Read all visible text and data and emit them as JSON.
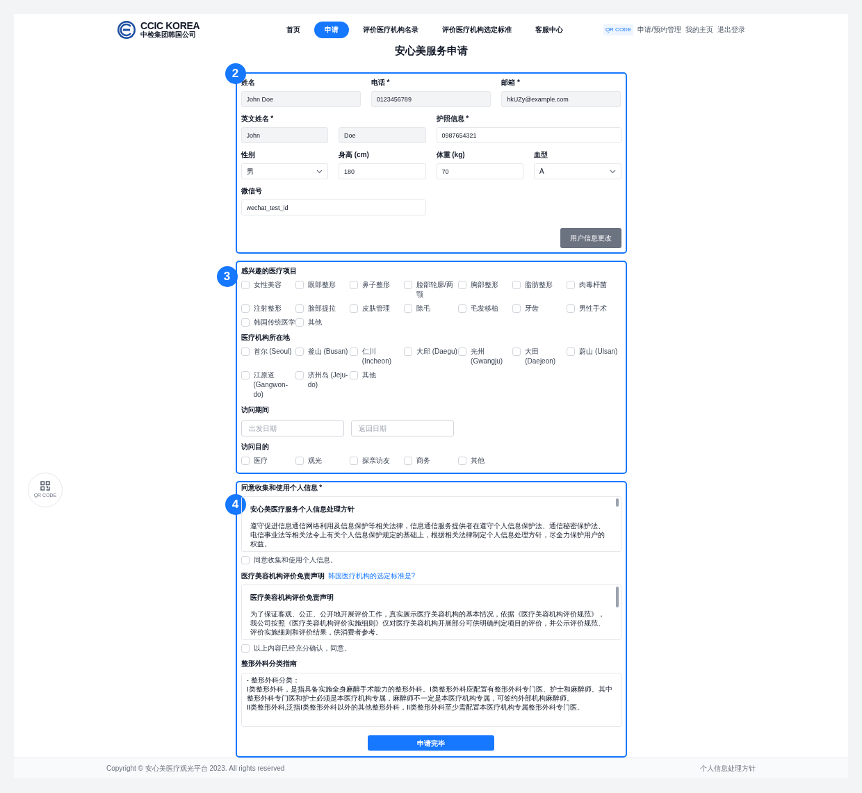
{
  "header": {
    "logo": {
      "title": "CCIC KOREA",
      "subtitle": "中检集团韩国公司"
    },
    "nav": [
      {
        "label": "首页",
        "selected": false
      },
      {
        "label": "申请",
        "selected": true
      },
      {
        "label": "评价医疗机构名录",
        "selected": false
      },
      {
        "label": "评价医疗机构选定标准",
        "selected": false
      },
      {
        "label": "客服中心",
        "selected": false
      }
    ],
    "top_links": [
      {
        "label": "QR CODE",
        "kind": "badge"
      },
      {
        "label": "申请/预约管理",
        "kind": "link"
      },
      {
        "label": "我的主页",
        "kind": "link"
      },
      {
        "label": "退出登录",
        "kind": "link"
      }
    ]
  },
  "page_title": "安心美服务申请",
  "floating_qr": {
    "label": "QR CODE"
  },
  "profile": {
    "marker": "2",
    "contact": [
      {
        "label": "姓名",
        "inputs": [
          {
            "kind": "text",
            "value": "John Doe",
            "readonly": true
          }
        ]
      },
      {
        "label": "电话 *",
        "inputs": [
          {
            "kind": "text",
            "value": "0123456789",
            "readonly": true
          }
        ]
      },
      {
        "label": "邮箱 *",
        "inputs": [
          {
            "kind": "text",
            "value": "hkUZy@example.com",
            "readonly": true
          }
        ]
      }
    ],
    "details": [
      {
        "label": "英文姓名 *",
        "inputs": [
          {
            "kind": "text",
            "value": "John",
            "readonly": true
          },
          {
            "kind": "text",
            "value": "Doe",
            "readonly": true
          }
        ]
      },
      {
        "label": "护照信息 *",
        "inputs": [
          {
            "kind": "text",
            "value": "0987654321",
            "readonly": false
          }
        ]
      },
      {
        "label": "性别",
        "inputs": [
          {
            "kind": "select",
            "value": "男",
            "readonly": false
          }
        ]
      },
      {
        "label": "身高 (cm)",
        "inputs": [
          {
            "kind": "text",
            "value": "180",
            "readonly": false
          }
        ]
      },
      {
        "label": "体重 (kg)",
        "inputs": [
          {
            "kind": "text",
            "value": "70",
            "readonly": false
          }
        ]
      },
      {
        "label": "血型",
        "inputs": [
          {
            "kind": "select",
            "value": "A",
            "readonly": false
          }
        ]
      },
      {
        "label": "微信号",
        "inputs": [
          {
            "kind": "text",
            "value": "wechat_test_id",
            "readonly": false
          }
        ]
      }
    ],
    "button": "用户信息更改"
  },
  "preferences": {
    "marker": "3",
    "groups": [
      {
        "kind": "checkboxes",
        "title": "感兴趣的医疗项目",
        "options": [
          {
            "label": "女性美容",
            "checked": false
          },
          {
            "label": "眼部整形",
            "checked": false
          },
          {
            "label": "鼻子整形",
            "checked": false
          },
          {
            "label": "脸部轮廓/两颚",
            "checked": false
          },
          {
            "label": "胸部整形",
            "checked": false
          },
          {
            "label": "脂肪整形",
            "checked": false
          },
          {
            "label": "肉毒杆菌",
            "checked": false
          },
          {
            "label": "注射整形",
            "checked": false
          },
          {
            "label": "脸部提拉",
            "checked": false
          },
          {
            "label": "皮肤管理",
            "checked": false
          },
          {
            "label": "除毛",
            "checked": false
          },
          {
            "label": "毛发移植",
            "checked": false
          },
          {
            "label": "牙齿",
            "checked": false
          },
          {
            "label": "男性手术",
            "checked": false
          },
          {
            "label": "韩国传统医学",
            "checked": false
          },
          {
            "label": "其他",
            "checked": false
          }
        ]
      },
      {
        "kind": "checkboxes",
        "title": "医疗机构所在地",
        "options": [
          {
            "label": "首尔 (Seoul)",
            "checked": false
          },
          {
            "label": "釜山 (Busan)",
            "checked": false
          },
          {
            "label": "仁川 (Incheon)",
            "checked": false
          },
          {
            "label": "大邱 (Daegu)",
            "checked": false
          },
          {
            "label": "光州 (Gwangju)",
            "checked": false
          },
          {
            "label": "大田 (Daejeon)",
            "checked": false
          },
          {
            "label": "蔚山 (Ulsan)",
            "checked": false
          },
          {
            "label": "江原道 (Gangwon-do)",
            "checked": false
          },
          {
            "label": "济州岛 (Jeju-do)",
            "checked": false
          },
          {
            "label": "其他",
            "checked": false
          }
        ]
      },
      {
        "kind": "dates",
        "title": "访问期间",
        "fields": [
          {
            "placeholder": "出发日期"
          },
          {
            "placeholder": "返回日期"
          }
        ]
      },
      {
        "kind": "checkboxes",
        "title": "访问目的",
        "options": [
          {
            "label": "医疗",
            "checked": false
          },
          {
            "label": "观光",
            "checked": false
          },
          {
            "label": "探亲访友",
            "checked": false
          },
          {
            "label": "商务",
            "checked": false
          },
          {
            "label": "其他",
            "checked": false
          }
        ]
      }
    ]
  },
  "consent": {
    "marker": "4",
    "blocks": [
      {
        "kind": "policy",
        "label": "同意收集和使用个人信息 *",
        "heading": "安心美医疗服务个人信息处理方针",
        "body": "遵守促进信息通信网络利用及信息保护等相关法律，信息通信服务提供者在遵守个人信息保护法、通信秘密保护法、电信事业法等相关法令上有关个人信息保护规定的基础上，根据相关法律制定个人信息处理方针，尽全力保护用户的权益。",
        "agree": {
          "label": "同意收集和使用个人信息。",
          "checked": false
        }
      },
      {
        "kind": "policy",
        "label": "医疗美容机构评价免责声明",
        "link": "韩国医疗机构的选定标准是?",
        "heading": "医疗美容机构评价免责声明",
        "body": "为了保证客观、公正、公开地开展评价工作，真实展示医疗美容机构的基本情况，依据《医疗美容机构评价规范》，我公司按照《医疗美容机构评价实施细则》仅对医疗美容机构开展部分可供明确判定项目的评价，并公示评价规范、评价实施细则和评价结果，供消费者参考。",
        "agree": {
          "label": "以上内容已经充分确认，同意。",
          "checked": false
        }
      },
      {
        "kind": "guide",
        "label": "整形外科分类指南",
        "lines": [
          "- 整形外科分类：",
          "Ⅰ类整形外科，是指具备实施全身麻醉手术能力的整形外科。Ⅰ类整形外科应配置有整形外科专门医、护士和麻醉师。其中整形外科专门医和护士必须是本医疗机构专属，麻醉师不一定是本医疗机构专属，可签约外部机构麻醉师。",
          "Ⅱ类整形外科,泛指Ⅰ类整形外科以外的其他整形外科，Ⅱ类整形外科至少需配置本医疗机构专属整形外科专门医。"
        ]
      }
    ],
    "submit": "申请完毕"
  },
  "footer": {
    "copyright": "Copyright © 安心美医疗观光平台 2023. All rights reserved",
    "link": "个人信息处理方针"
  }
}
